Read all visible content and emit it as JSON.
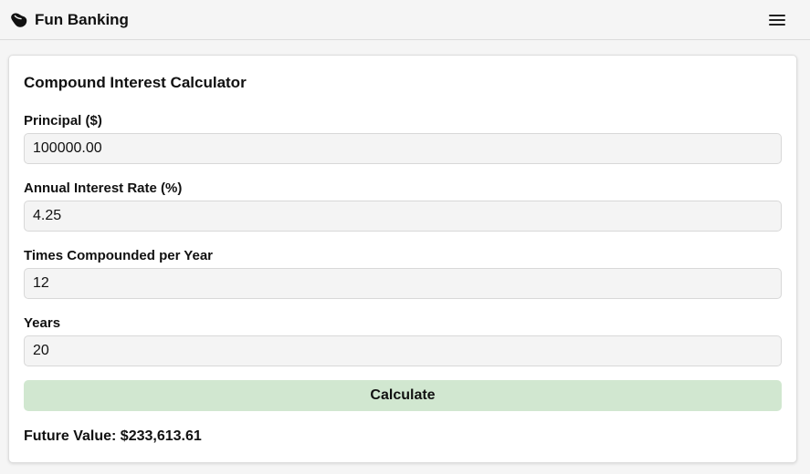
{
  "navbar": {
    "brand_name": "Fun Banking",
    "logo_icon": "bean-logo-icon",
    "menu_icon": "hamburger-menu-icon"
  },
  "calculator": {
    "title": "Compound Interest Calculator",
    "fields": [
      {
        "label": "Principal ($)",
        "value": "100000.00"
      },
      {
        "label": "Annual Interest Rate (%)",
        "value": "4.25"
      },
      {
        "label": "Times Compounded per Year",
        "value": "12"
      },
      {
        "label": "Years",
        "value": "20"
      }
    ],
    "calculate_label": "Calculate",
    "result_text": "Future Value: $233,613.61"
  },
  "colors": {
    "background": "#f5f5f5",
    "card": "#ffffff",
    "button": "#d1e7d0",
    "input": "#f4f4f4"
  }
}
